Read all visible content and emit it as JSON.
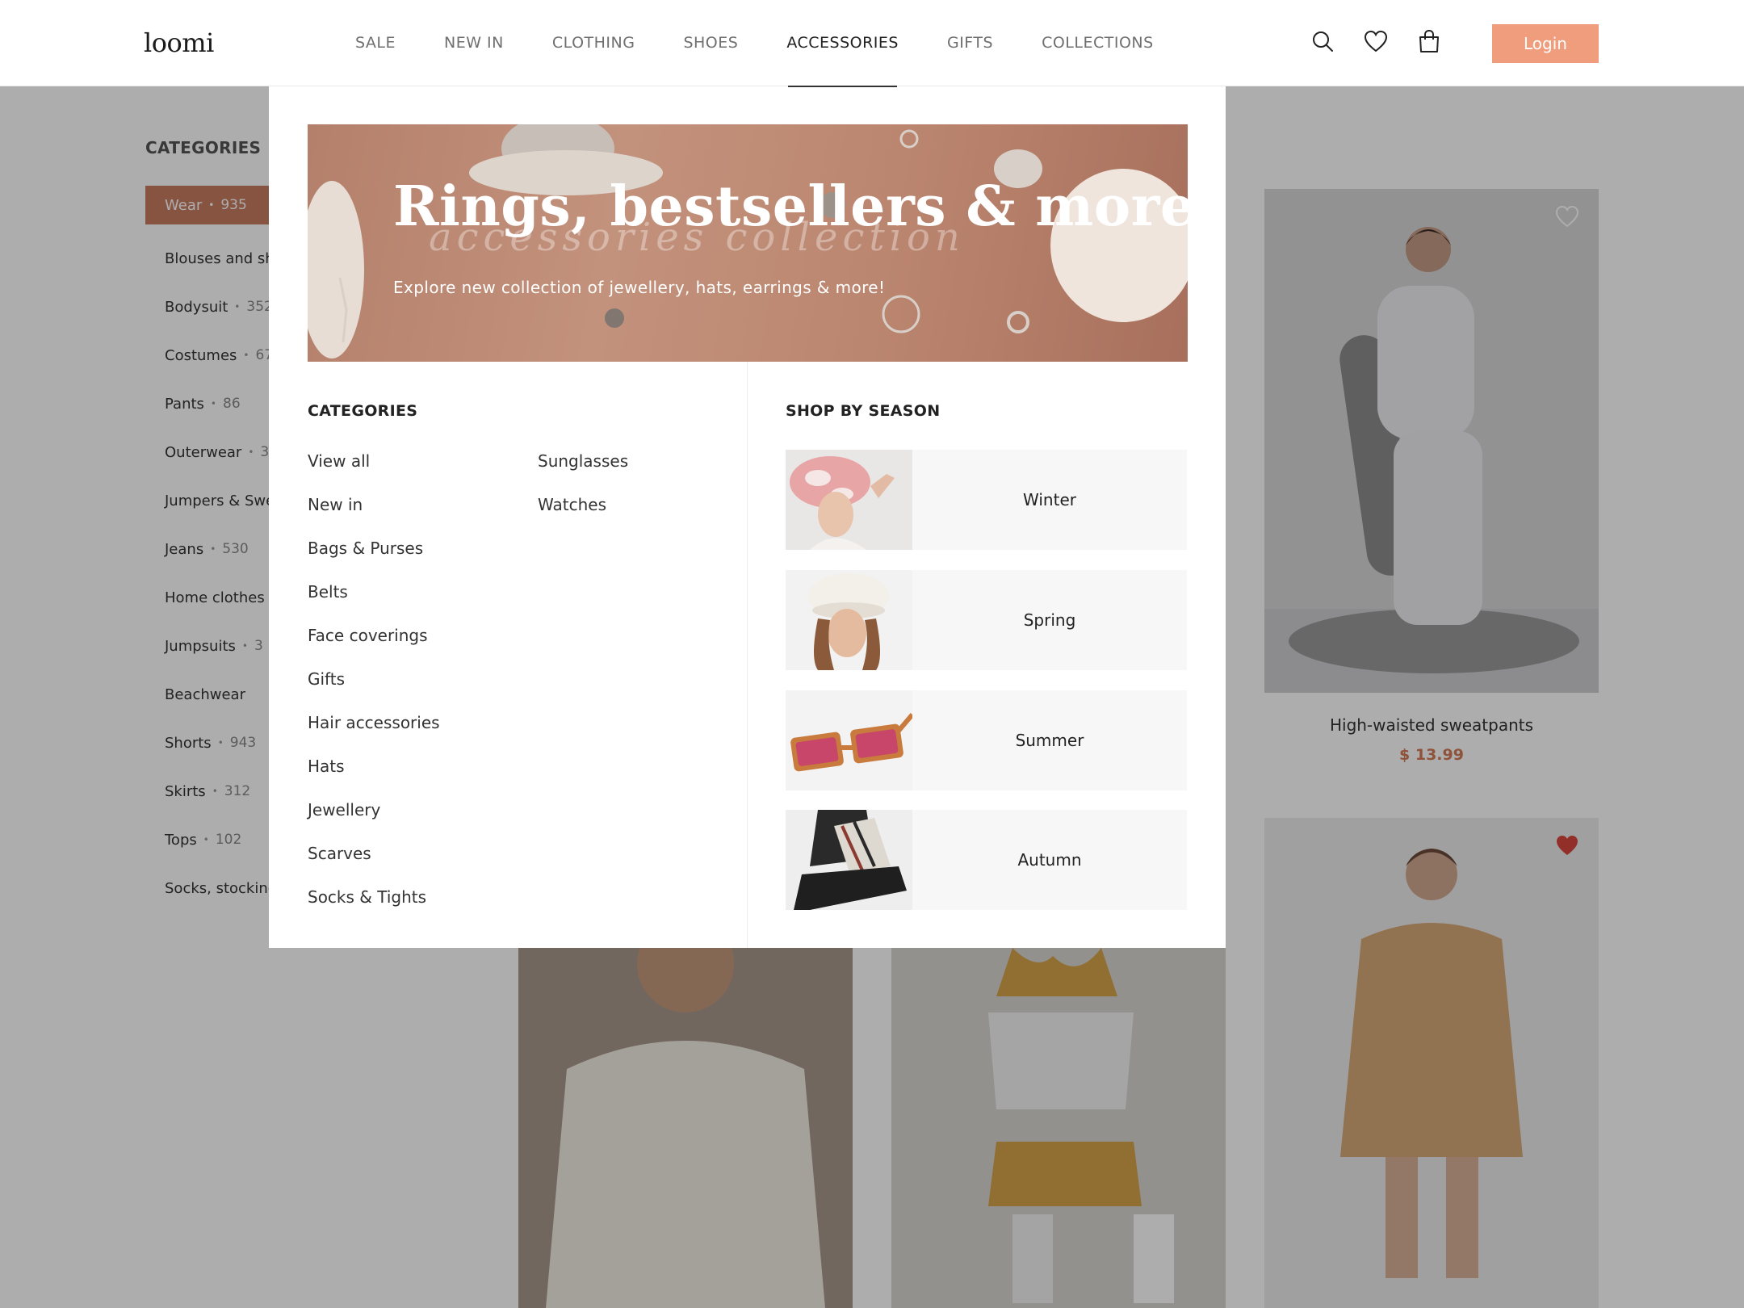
{
  "header": {
    "logo": "loomi",
    "nav": [
      "SALE",
      "NEW IN",
      "CLOTHING",
      "SHOES",
      "ACCESSORIES",
      "GIFTS",
      "COLLECTIONS"
    ],
    "active_nav": "ACCESSORIES",
    "login_label": "Login",
    "icons": [
      "search-icon",
      "heart-icon",
      "bag-icon"
    ]
  },
  "sidebar": {
    "title": "CATEGORIES",
    "items": [
      {
        "label": "Wear",
        "count": "935"
      },
      {
        "label": "Blouses and shirts",
        "count": ""
      },
      {
        "label": "Bodysuit",
        "count": "352"
      },
      {
        "label": "Costumes",
        "count": "67"
      },
      {
        "label": "Pants",
        "count": "86"
      },
      {
        "label": "Outerwear",
        "count": "3"
      },
      {
        "label": "Jumpers & Sweatshirts",
        "count": ""
      },
      {
        "label": "Jeans",
        "count": "530"
      },
      {
        "label": "Home clothes",
        "count": ""
      },
      {
        "label": "Jumpsuits",
        "count": "3"
      },
      {
        "label": "Beachwear",
        "count": ""
      },
      {
        "label": "Shorts",
        "count": "943"
      },
      {
        "label": "Skirts",
        "count": "312"
      },
      {
        "label": "Tops",
        "count": "102"
      },
      {
        "label": "Socks, stockings",
        "count": ""
      }
    ]
  },
  "products": [
    {
      "name": "High-waisted sweatpants",
      "price": "$ 13.99",
      "favorite": false
    }
  ],
  "mega_menu": {
    "banner": {
      "title": "Rings, bestsellers & more",
      "script": "accessories collection",
      "subtitle": "Explore new collection of jewellery, hats,  earrings & more!"
    },
    "categories_title": "CATEGORIES",
    "categories_col1": [
      "View all",
      "New in",
      "Bags & Purses",
      "Belts",
      "Face coverings",
      "Gifts",
      "Hair accessories",
      "Hats",
      "Jewellery",
      "Scarves",
      "Socks & Tights"
    ],
    "categories_col2": [
      "Sunglasses",
      "Watches"
    ],
    "season_title": "SHOP BY SEASON",
    "seasons": [
      "Winter",
      "Spring",
      "Summer",
      "Autumn"
    ]
  },
  "colors": {
    "accent": "#ef9d7c",
    "active_category": "#c87d62",
    "price": "#d37a56",
    "favorite_heart": "#d9463d"
  }
}
